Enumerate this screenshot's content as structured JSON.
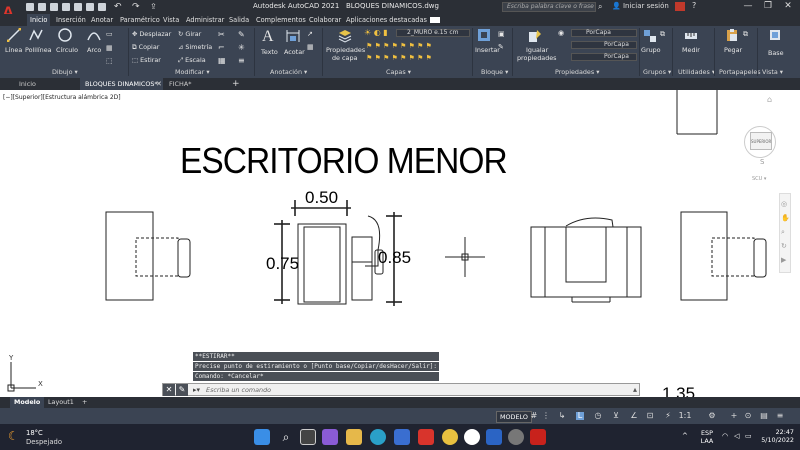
{
  "window": {
    "app_title": "Autodesk AutoCAD 2021",
    "file_name": "BLOQUES DINAMICOS.dwg",
    "search_placeholder": "Escriba palabra clave o frase",
    "sign_in": "Iniciar sesión",
    "minimize": "—",
    "maximize": "❐",
    "close": "✕"
  },
  "menu_tabs": [
    "Inicio",
    "Inserción",
    "Anotar",
    "Paramétrico",
    "Vista",
    "Administrar",
    "Salida",
    "Complementos",
    "Colaborar",
    "Aplicaciones destacadas"
  ],
  "ribbon": {
    "draw": {
      "linea": "Línea",
      "polilinea": "Polilínea",
      "circulo": "Círculo",
      "arco": "Arco",
      "title": "Dibujo ▾"
    },
    "modify": {
      "desplazar": "Desplazar",
      "girar": "Girar",
      "copiar": "Copiar",
      "simetria": "Simetría",
      "estirar": "Estirar",
      "escala": "Escala",
      "title": "Modificar ▾"
    },
    "annotation": {
      "texto": "Texto",
      "acotar": "Acotar",
      "title": "Anotación ▾"
    },
    "layers": {
      "propiedades_capa_1": "Propiedades",
      "propiedades_capa_2": "de capa",
      "layer_name": "2_MURO e.15 cm",
      "title": "Capas ▾"
    },
    "block": {
      "insertar": "Insertar",
      "title": "Bloque ▾"
    },
    "properties": {
      "igualar_1": "Igualar",
      "igualar_2": "propiedades",
      "porcapa1": "PorCapa",
      "porcapa2": "PorCapa",
      "porcapa3": "PorCapa",
      "title": "Propiedades ▾"
    },
    "groups": {
      "grupo": "Grupo",
      "title": "Grupos ▾"
    },
    "utilities": {
      "medir": "Medir",
      "title": "Utilidades ▾"
    },
    "clipboard": {
      "pegar": "Pegar",
      "title": "Portapapeles"
    },
    "view": {
      "base": "Base",
      "title": "Vista ▾"
    }
  },
  "doc_tabs": [
    "Inicio",
    "BLOQUES DINAMICOS*",
    "FICHA*"
  ],
  "viewport": {
    "label": "[−][Superior][Estructura alámbrica 2D]",
    "drawing_title": "ESCRITORIO MENOR",
    "dim_width": "0.50",
    "dim_left": "0.75",
    "dim_right": "0.85",
    "dim_bottom": "1.35",
    "viewcube_top": "SUPERIOR",
    "viewcube_s": "S",
    "wcs": "SCU ▾",
    "ucs_x": "X",
    "ucs_y": "Y"
  },
  "command": {
    "history": [
      "**ESTIRAR**",
      "Precise punto de estiramiento o [Punto base/Copiar/desHacer/Salir]:",
      "Comando: *Cancelar*"
    ],
    "placeholder": "Escriba un comando"
  },
  "layout_tabs": [
    "Modelo",
    "Layout1",
    "+"
  ],
  "status": {
    "model": "MODELO",
    "scale": "1:1"
  },
  "taskbar": {
    "temp": "18°C",
    "weather": "Despejado",
    "lang1": "ESP",
    "lang2": "LAA",
    "time": "22:47",
    "date": "5/10/2022"
  }
}
